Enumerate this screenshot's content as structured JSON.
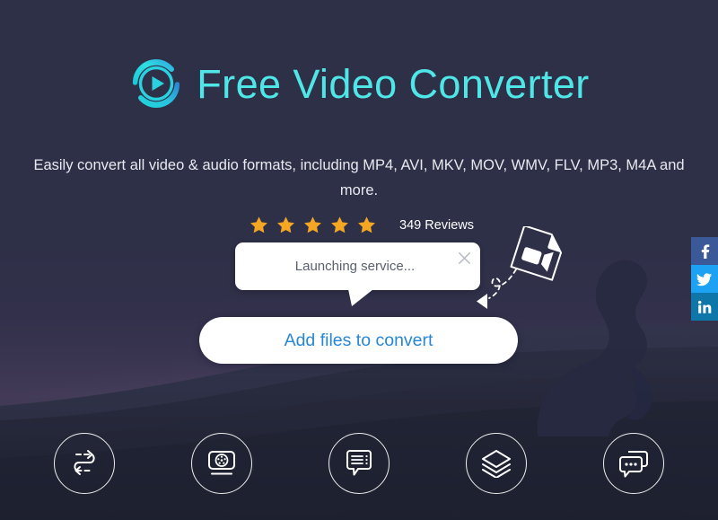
{
  "app": {
    "title": "Free Video Converter",
    "logo_icon": "play-circle-logo",
    "title_color": "#4fe6e8",
    "background_color": "#2e3048"
  },
  "hero": {
    "subtitle": "Easily convert all video & audio formats, including MP4, AVI, MKV, MOV, WMV, FLV, MP3, M4A and more.",
    "rating": {
      "stars_filled": 5,
      "star_icon": "star-icon",
      "star_color": "#f5a623",
      "reviews_label": "349 Reviews"
    },
    "cta": {
      "label": "Add files to convert",
      "text_color": "#2787d4",
      "background_color": "#ffffff"
    }
  },
  "popup": {
    "message": "Launching service...",
    "close_icon": "close-icon",
    "background_color": "#ffffff",
    "text_color": "#5b6071"
  },
  "drop_hint": {
    "file_icon": "video-file-icon",
    "arrow_icon": "dashed-curved-arrow-icon"
  },
  "features": [
    {
      "name": "convert",
      "icon": "convert-arrows-icon"
    },
    {
      "name": "screen-record",
      "icon": "screen-recorder-icon"
    },
    {
      "name": "subtitles",
      "icon": "subtitle-bubble-icon"
    },
    {
      "name": "batch",
      "icon": "layers-icon"
    },
    {
      "name": "support",
      "icon": "chat-bubbles-icon"
    }
  ],
  "social": [
    {
      "network": "facebook",
      "icon": "facebook-icon",
      "glyph": "f",
      "color": "#3b5998"
    },
    {
      "network": "twitter",
      "icon": "twitter-icon",
      "glyph": "t",
      "color": "#1da1f2"
    },
    {
      "network": "linkedin",
      "icon": "linkedin-icon",
      "glyph": "in",
      "color": "#0e76a8"
    }
  ]
}
